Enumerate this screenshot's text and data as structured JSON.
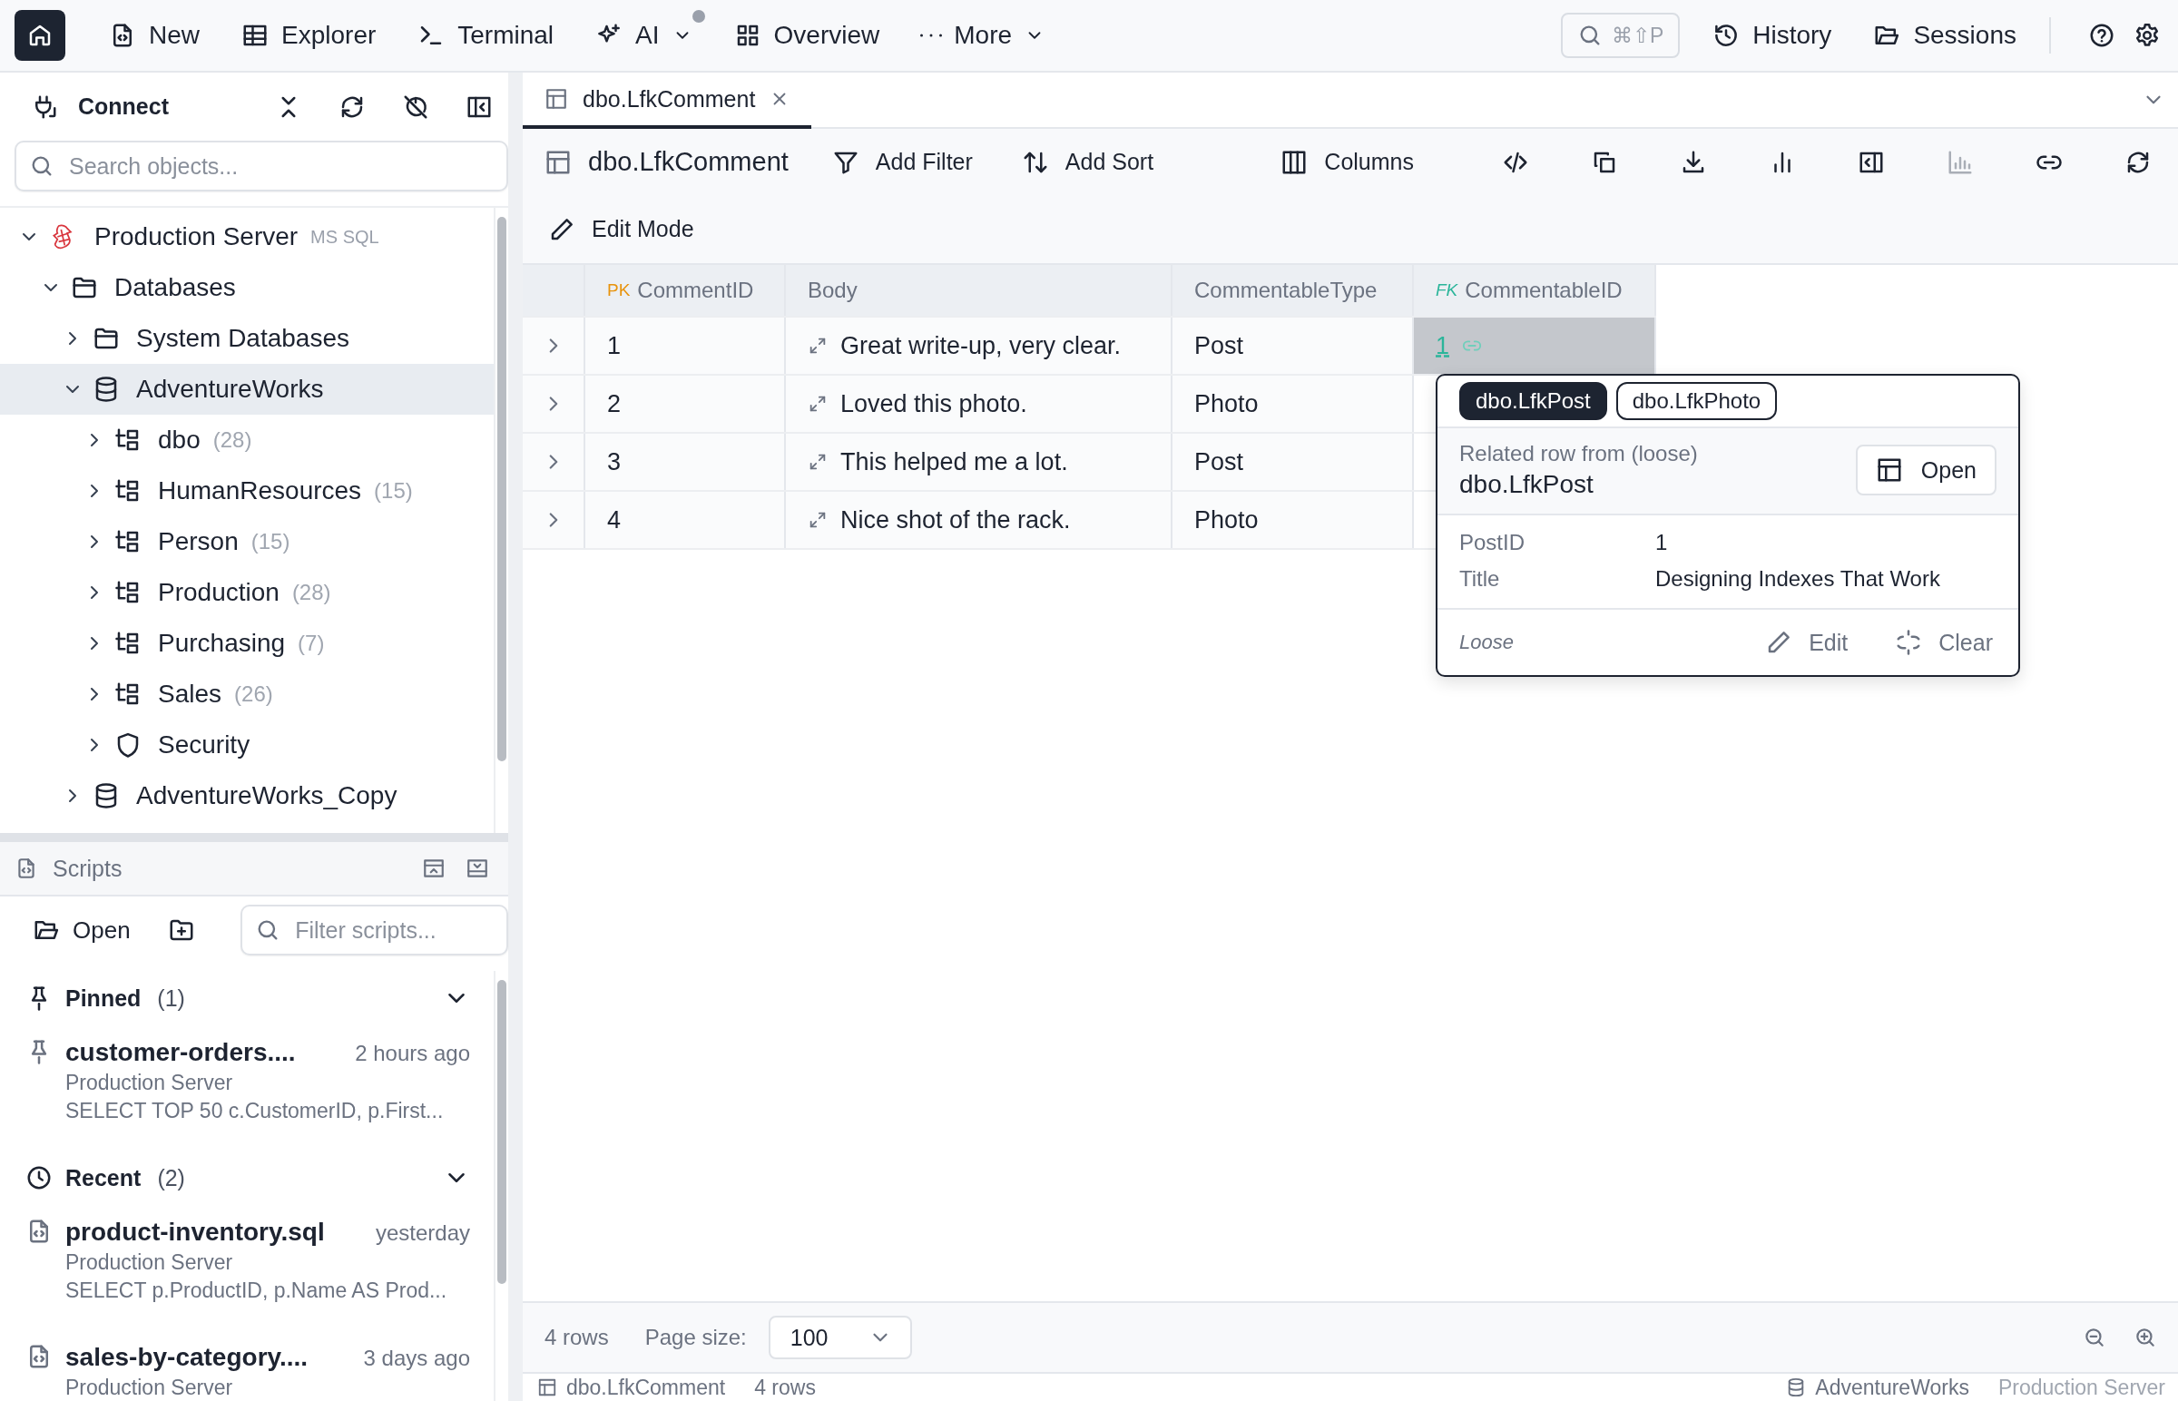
{
  "top_nav": {
    "items": [
      {
        "kind": "home",
        "selected": true
      },
      {
        "kind": "new",
        "label": "New",
        "selected": false
      },
      {
        "kind": "explorer",
        "label": "Explorer",
        "selected": false
      },
      {
        "kind": "terminal",
        "label": "Terminal",
        "selected": false
      },
      {
        "kind": "ai",
        "label": "AI",
        "selected": false,
        "dropdown": true,
        "notification": true
      },
      {
        "kind": "overview",
        "label": "Overview",
        "selected": false
      },
      {
        "kind": "more",
        "label": "More",
        "selected": false,
        "dropdown": true
      }
    ],
    "command_search": {
      "shortcut": "⌘⇧P"
    },
    "right_items": [
      {
        "kind": "history",
        "label": "History"
      },
      {
        "kind": "sessions",
        "label": "Sessions"
      },
      {
        "kind": "help"
      },
      {
        "kind": "settings"
      }
    ]
  },
  "explorer": {
    "title": "Connect",
    "search": {
      "placeholder": "Search objects..."
    },
    "tree": [
      {
        "kind": "server",
        "label": "Production Server",
        "tag": "MS SQL",
        "expanded": true,
        "selected": false,
        "children": [
          {
            "kind": "folder",
            "label": "Databases",
            "expanded": true,
            "selected": false,
            "children": [
              {
                "kind": "folder",
                "label": "System Databases",
                "expanded": false,
                "selected": false
              },
              {
                "kind": "database",
                "label": "AdventureWorks",
                "expanded": true,
                "selected": true,
                "children": [
                  {
                    "kind": "schema",
                    "label": "dbo",
                    "count": "(28)",
                    "expanded": false,
                    "selected": false
                  },
                  {
                    "kind": "schema",
                    "label": "HumanResources",
                    "count": "(15)",
                    "expanded": false,
                    "selected": false
                  },
                  {
                    "kind": "schema",
                    "label": "Person",
                    "count": "(15)",
                    "expanded": false,
                    "selected": false
                  },
                  {
                    "kind": "schema",
                    "label": "Production",
                    "count": "(28)",
                    "expanded": false,
                    "selected": false
                  },
                  {
                    "kind": "schema",
                    "label": "Purchasing",
                    "count": "(7)",
                    "expanded": false,
                    "selected": false
                  },
                  {
                    "kind": "schema",
                    "label": "Sales",
                    "count": "(26)",
                    "expanded": false,
                    "selected": false
                  },
                  {
                    "kind": "security",
                    "label": "Security",
                    "expanded": false,
                    "selected": false
                  }
                ]
              },
              {
                "kind": "database",
                "label": "AdventureWorks_Copy",
                "expanded": false,
                "selected": false
              }
            ]
          }
        ]
      }
    ]
  },
  "scripts": {
    "title": "Scripts",
    "open_label": "Open",
    "filter": {
      "placeholder": "Filter scripts..."
    },
    "sections": [
      {
        "kind": "pinned",
        "label": "Pinned",
        "count": "(1)",
        "expanded": true,
        "items": [
          {
            "name": "customer-orders....",
            "time": "2 hours ago",
            "server": "Production Server",
            "preview": "SELECT TOP 50 c.CustomerID, p.First..."
          }
        ]
      },
      {
        "kind": "recent",
        "label": "Recent",
        "count": "(2)",
        "expanded": true,
        "items": [
          {
            "name": "product-inventory.sql",
            "time": "yesterday",
            "server": "Production Server",
            "preview": "SELECT p.ProductID, p.Name AS Prod..."
          },
          {
            "name": "sales-by-category....",
            "time": "3 days ago",
            "server": "Production Server"
          }
        ]
      }
    ]
  },
  "tabs": [
    {
      "label": "dbo.LfkComment",
      "selected": true
    }
  ],
  "toolbar": {
    "table": "dbo.LfkComment",
    "actions": [
      {
        "kind": "filter",
        "label": "Add Filter"
      },
      {
        "kind": "sort",
        "label": "Add Sort"
      }
    ],
    "columns_label": "Columns",
    "icon_buttons": [
      {
        "kind": "code",
        "disabled": false
      },
      {
        "kind": "copy",
        "disabled": false
      },
      {
        "kind": "download",
        "disabled": false
      },
      {
        "kind": "bars",
        "disabled": false
      },
      {
        "kind": "panel",
        "disabled": false
      },
      {
        "kind": "chart",
        "disabled": true
      },
      {
        "kind": "link",
        "disabled": false
      },
      {
        "kind": "refresh",
        "disabled": false
      }
    ],
    "edit_mode_label": "Edit Mode"
  },
  "grid": {
    "columns": [
      {
        "kind": "text",
        "key": {
          "kind": "primary",
          "label": "PK"
        },
        "label": "CommentID"
      },
      {
        "kind": "long_text",
        "label": "Body"
      },
      {
        "kind": "text",
        "label": "CommentableType"
      },
      {
        "kind": "foreign",
        "key": {
          "kind": "foreign",
          "label": "FK"
        },
        "label": "CommentableID"
      }
    ],
    "rows": [
      {
        "expanded": false,
        "cells": [
          {
            "text": "1",
            "selected": false
          },
          {
            "text": "Great write-up, very clear.",
            "selected": false
          },
          {
            "text": "Post",
            "selected": false
          },
          {
            "text": "1",
            "selected": true
          }
        ]
      },
      {
        "expanded": false,
        "cells": [
          {
            "text": "2",
            "selected": false
          },
          {
            "text": "Loved this photo.",
            "selected": false
          },
          {
            "text": "Photo",
            "selected": false
          }
        ]
      },
      {
        "expanded": false,
        "cells": [
          {
            "text": "3",
            "selected": false
          },
          {
            "text": "This helped me a lot.",
            "selected": false
          },
          {
            "text": "Post",
            "selected": false
          }
        ]
      },
      {
        "expanded": false,
        "cells": [
          {
            "text": "4",
            "selected": false
          },
          {
            "text": "Nice shot of the rack.",
            "selected": false
          },
          {
            "text": "Photo",
            "selected": false
          }
        ]
      }
    ]
  },
  "popover": {
    "tabs": [
      {
        "label": "dbo.LfkPost",
        "selected": true
      },
      {
        "label": "dbo.LfkPhoto",
        "selected": false
      }
    ],
    "caption": "Related row from (loose)",
    "table": "dbo.LfkPost",
    "open_label": "Open",
    "fields": [
      {
        "label": "PostID",
        "value": "1"
      },
      {
        "label": "Title",
        "value": "Designing Indexes That Work"
      }
    ],
    "mode": "Loose",
    "edit_label": "Edit",
    "clear_label": "Clear"
  },
  "footer": {
    "row_count": "4 rows",
    "page_size_label": "Page size:",
    "page_size": "100"
  },
  "status_bar": {
    "table": "dbo.LfkComment",
    "rows": "4 rows",
    "database": "AdventureWorks",
    "server": "Production Server"
  }
}
